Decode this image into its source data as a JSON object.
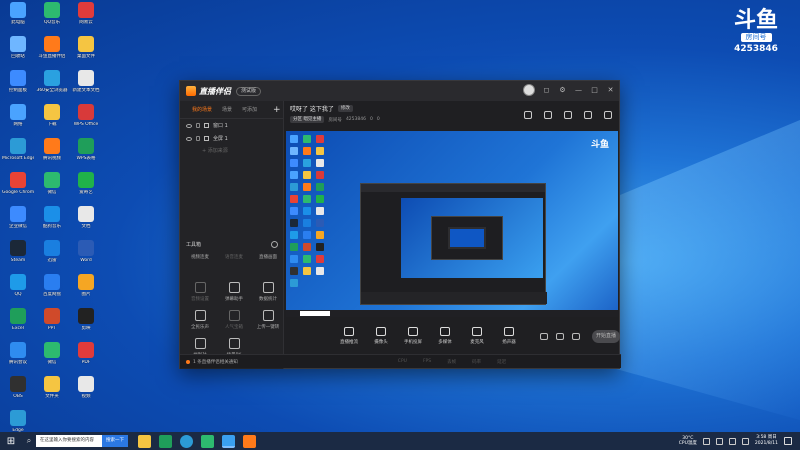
{
  "desktop": {
    "icons": [
      {
        "label": "此电脑",
        "color": "#4aa3ff"
      },
      {
        "label": "QQ音乐",
        "color": "#2dba6f"
      },
      {
        "label": "网易云",
        "color": "#e03b3b"
      },
      {
        "label": "回收站",
        "color": "#6fb6ff"
      },
      {
        "label": "斗鱼直播伴侣",
        "color": "#ff7a1a"
      },
      {
        "label": "桌面文件",
        "color": "#f5c542"
      },
      {
        "label": "控制面板",
        "color": "#3d8bff"
      },
      {
        "label": "360安全浏览器",
        "color": "#2aa1e0"
      },
      {
        "label": "新建文本文档",
        "color": "#e8e8e8"
      },
      {
        "label": "网络",
        "color": "#4aa3ff"
      },
      {
        "label": "下载",
        "color": "#f5c542"
      },
      {
        "label": "WPS Office",
        "color": "#d83a3a"
      },
      {
        "label": "Microsoft Edge",
        "color": "#2c9bd6"
      },
      {
        "label": "腾讯视频",
        "color": "#ff7a1a"
      },
      {
        "label": "WPS表格",
        "color": "#1f9e5a"
      },
      {
        "label": "Google Chrome",
        "color": "#e94335"
      },
      {
        "label": "微信",
        "color": "#2dba6f"
      },
      {
        "label": "爱奇艺",
        "color": "#20b24a"
      },
      {
        "label": "企业微信",
        "color": "#3d8bff"
      },
      {
        "label": "酷狗音乐",
        "color": "#1b8fe8"
      },
      {
        "label": "文档",
        "color": "#e8e8e8"
      },
      {
        "label": "Steam",
        "color": "#1b2838"
      },
      {
        "label": "迅雷",
        "color": "#1a7fe0"
      },
      {
        "label": "Word",
        "color": "#2b5bb5"
      },
      {
        "label": "QQ",
        "color": "#1e9be9"
      },
      {
        "label": "百度网盘",
        "color": "#2a7ef0"
      },
      {
        "label": "图片",
        "color": "#f5a623"
      },
      {
        "label": "Excel",
        "color": "#1f9e5a"
      },
      {
        "label": "PPT",
        "color": "#d04a2a"
      },
      {
        "label": "剪映",
        "color": "#222222"
      },
      {
        "label": "腾讯会议",
        "color": "#2f8cf0"
      },
      {
        "label": "微信",
        "color": "#2dba6f"
      },
      {
        "label": "PDF",
        "color": "#e03b3b"
      },
      {
        "label": "OBS",
        "color": "#303030"
      },
      {
        "label": "文件夹",
        "color": "#f5c542"
      },
      {
        "label": "视频",
        "color": "#e8e8e8"
      },
      {
        "label": "Edge",
        "color": "#2c9bd6"
      }
    ]
  },
  "douyu_badge": {
    "logo": "斗鱼",
    "room_label": "房间号",
    "room_number": "4253846"
  },
  "app": {
    "name": "直播伴侣",
    "version_badge": "测试版",
    "tabs": [
      "我的场景",
      "场景",
      "可添加"
    ],
    "tab_add": "+",
    "sources": [
      "窗口 1",
      "全屏 1"
    ],
    "add_source": "+ 添加来源",
    "toolbox_title": "工具箱",
    "tools_row1": [
      "视频连麦",
      "语音连麦",
      "直播画面"
    ],
    "tools_row2": [
      "音频设置",
      "弹幕助手",
      "数据统计"
    ],
    "tools_row3": [
      "全民乐声",
      "人气宝箱",
      "上传一键转"
    ],
    "tools_row4": [
      "福利社",
      "场景PK"
    ],
    "stream_title": "哎呀了 这下我了",
    "edit_label": "修改",
    "meta": {
      "category_label": "分区",
      "category": "唱见主播",
      "room_label": "房间号",
      "room_value": "4253846",
      "fans": "0",
      "viewers": "0"
    },
    "controls": [
      "直播推流",
      "摄像头",
      "手机投屏",
      "多媒体",
      "麦克风",
      "扬声器"
    ],
    "start_button": "开始直播",
    "status_message": "1 条直播伴侣相关通知",
    "status_stats": [
      "CPU",
      "FPS",
      "丢帧",
      "码率",
      "延迟"
    ]
  },
  "taskbar": {
    "search_text": "在这里输入你要搜索的内容",
    "search_button": "搜索一下",
    "weather_line1": "30°C",
    "weather_line2": "CPU温度",
    "time": "3:58 周日",
    "date": "2021/8/11"
  }
}
